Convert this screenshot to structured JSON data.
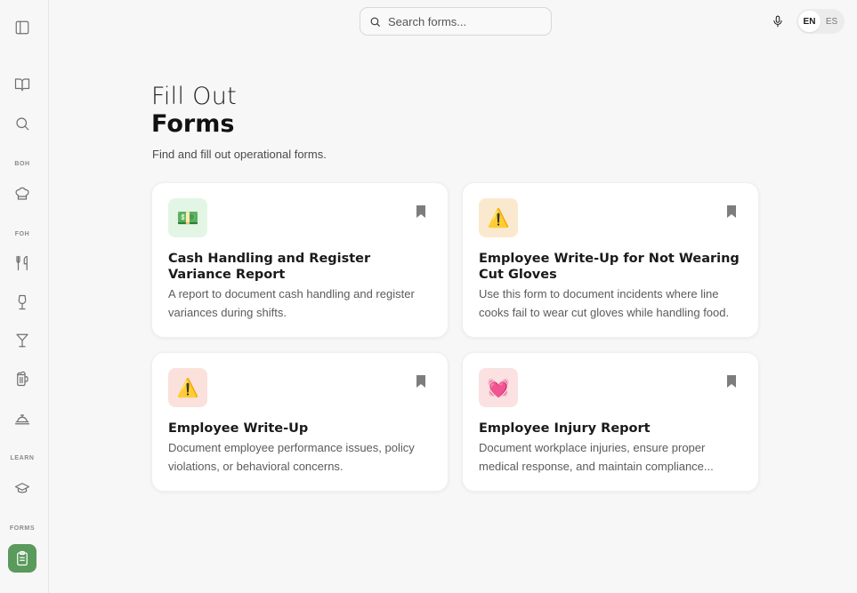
{
  "search": {
    "placeholder": "Search forms..."
  },
  "language": {
    "options": [
      "EN",
      "ES"
    ],
    "selected": "EN"
  },
  "sidebar": {
    "sections": {
      "boh": "BOH",
      "foh": "FOH",
      "learn": "LEARN",
      "forms": "FORMS"
    },
    "icons": [
      "sidebar-toggle-icon",
      "book-icon",
      "search-icon",
      "chef-hat-icon",
      "utensils-icon",
      "wine-glass-icon",
      "martini-icon",
      "beer-mug-icon",
      "service-bell-icon",
      "graduation-cap-icon",
      "clipboard-icon"
    ],
    "active": "forms"
  },
  "page": {
    "title_light": "Fill Out",
    "title_bold": "Forms",
    "subtitle": "Find and fill out operational forms."
  },
  "cards": [
    {
      "emoji": "💵",
      "emoji_bg": "#e3f6e5",
      "title": "Cash Handling and Register Variance Report",
      "description": "A report to document cash handling and register variances during shifts."
    },
    {
      "emoji": "⚠️",
      "emoji_bg": "#fbe9cf",
      "title": "Employee Write-Up for Not Wearing Cut Gloves",
      "description": "Use this form to document incidents where line cooks fail to wear cut gloves while handling food."
    },
    {
      "emoji": "⚠️",
      "emoji_bg": "#fbe1dc",
      "title": "Employee Write-Up",
      "description": "Document employee performance issues, policy violations, or behavioral concerns."
    },
    {
      "emoji": "💓",
      "emoji_bg": "#fbe1e1",
      "title": "Employee Injury Report",
      "description": "Document workplace injuries, ensure proper medical response, and maintain compliance..."
    }
  ],
  "colors": {
    "accent": "#5a9a5c",
    "background": "#f7f7f7"
  }
}
